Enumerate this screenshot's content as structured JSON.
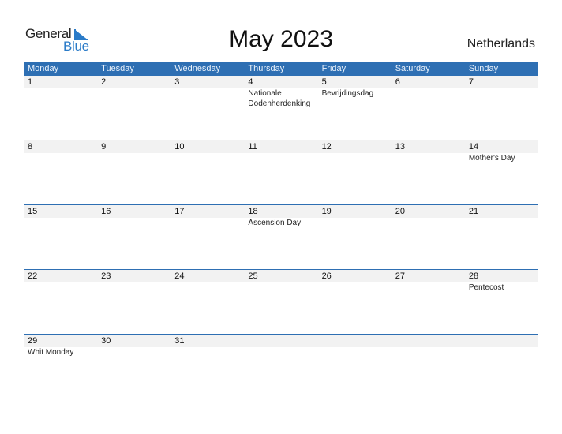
{
  "logo": {
    "part1": "General",
    "part2": "Blue"
  },
  "title": "May 2023",
  "country": "Netherlands",
  "colors": {
    "header_bg": "#2e6fb3",
    "brand": "#2a7bc8",
    "daynum_bg": "#f2f2f2"
  },
  "weekdays": [
    "Monday",
    "Tuesday",
    "Wednesday",
    "Thursday",
    "Friday",
    "Saturday",
    "Sunday"
  ],
  "weeks": [
    [
      {
        "day": "1",
        "holiday": ""
      },
      {
        "day": "2",
        "holiday": ""
      },
      {
        "day": "3",
        "holiday": ""
      },
      {
        "day": "4",
        "holiday": "Nationale Dodenherdenking"
      },
      {
        "day": "5",
        "holiday": "Bevrijdingsdag"
      },
      {
        "day": "6",
        "holiday": ""
      },
      {
        "day": "7",
        "holiday": ""
      }
    ],
    [
      {
        "day": "8",
        "holiday": ""
      },
      {
        "day": "9",
        "holiday": ""
      },
      {
        "day": "10",
        "holiday": ""
      },
      {
        "day": "11",
        "holiday": ""
      },
      {
        "day": "12",
        "holiday": ""
      },
      {
        "day": "13",
        "holiday": ""
      },
      {
        "day": "14",
        "holiday": "Mother's Day"
      }
    ],
    [
      {
        "day": "15",
        "holiday": ""
      },
      {
        "day": "16",
        "holiday": ""
      },
      {
        "day": "17",
        "holiday": ""
      },
      {
        "day": "18",
        "holiday": "Ascension Day"
      },
      {
        "day": "19",
        "holiday": ""
      },
      {
        "day": "20",
        "holiday": ""
      },
      {
        "day": "21",
        "holiday": ""
      }
    ],
    [
      {
        "day": "22",
        "holiday": ""
      },
      {
        "day": "23",
        "holiday": ""
      },
      {
        "day": "24",
        "holiday": ""
      },
      {
        "day": "25",
        "holiday": ""
      },
      {
        "day": "26",
        "holiday": ""
      },
      {
        "day": "27",
        "holiday": ""
      },
      {
        "day": "28",
        "holiday": "Pentecost"
      }
    ],
    [
      {
        "day": "29",
        "holiday": "Whit Monday"
      },
      {
        "day": "30",
        "holiday": ""
      },
      {
        "day": "31",
        "holiday": ""
      },
      {
        "day": "",
        "holiday": ""
      },
      {
        "day": "",
        "holiday": ""
      },
      {
        "day": "",
        "holiday": ""
      },
      {
        "day": "",
        "holiday": ""
      }
    ]
  ]
}
